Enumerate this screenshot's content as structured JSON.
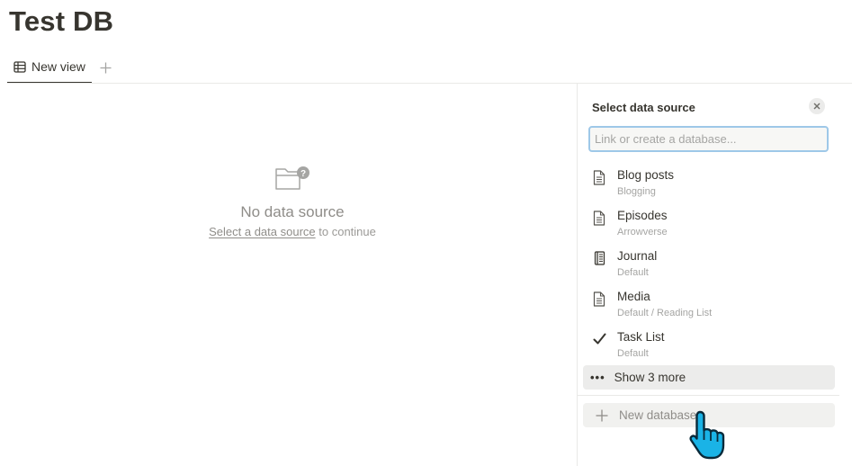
{
  "page": {
    "title": "Test DB"
  },
  "tabs": {
    "items": [
      {
        "label": "New view",
        "icon": "table-icon"
      }
    ],
    "add_icon": "plus-icon"
  },
  "empty_state": {
    "icon": "folder-question-icon",
    "title": "No data source",
    "link_text": "Select a data source",
    "suffix_text": "to continue"
  },
  "panel": {
    "title": "Select data source",
    "close_icon": "close-icon",
    "search_placeholder": "Link or create a database...",
    "search_value": "",
    "sources": [
      {
        "name": "Blog posts",
        "sub": "Blogging",
        "icon": "document-icon"
      },
      {
        "name": "Episodes",
        "sub": "Arrowverse",
        "icon": "document-icon"
      },
      {
        "name": "Journal",
        "sub": "Default",
        "icon": "notebook-icon"
      },
      {
        "name": "Media",
        "sub": "Default / Reading List",
        "icon": "document-icon"
      },
      {
        "name": "Task List",
        "sub": "Default",
        "icon": "checkmark-icon"
      }
    ],
    "show_more_label": "Show 3 more",
    "new_database_label": "New database"
  },
  "colors": {
    "text": "#37352f",
    "muted": "#a5a5a3",
    "focus_border": "#9ec8e8",
    "cursor": "#1ab3e6"
  }
}
